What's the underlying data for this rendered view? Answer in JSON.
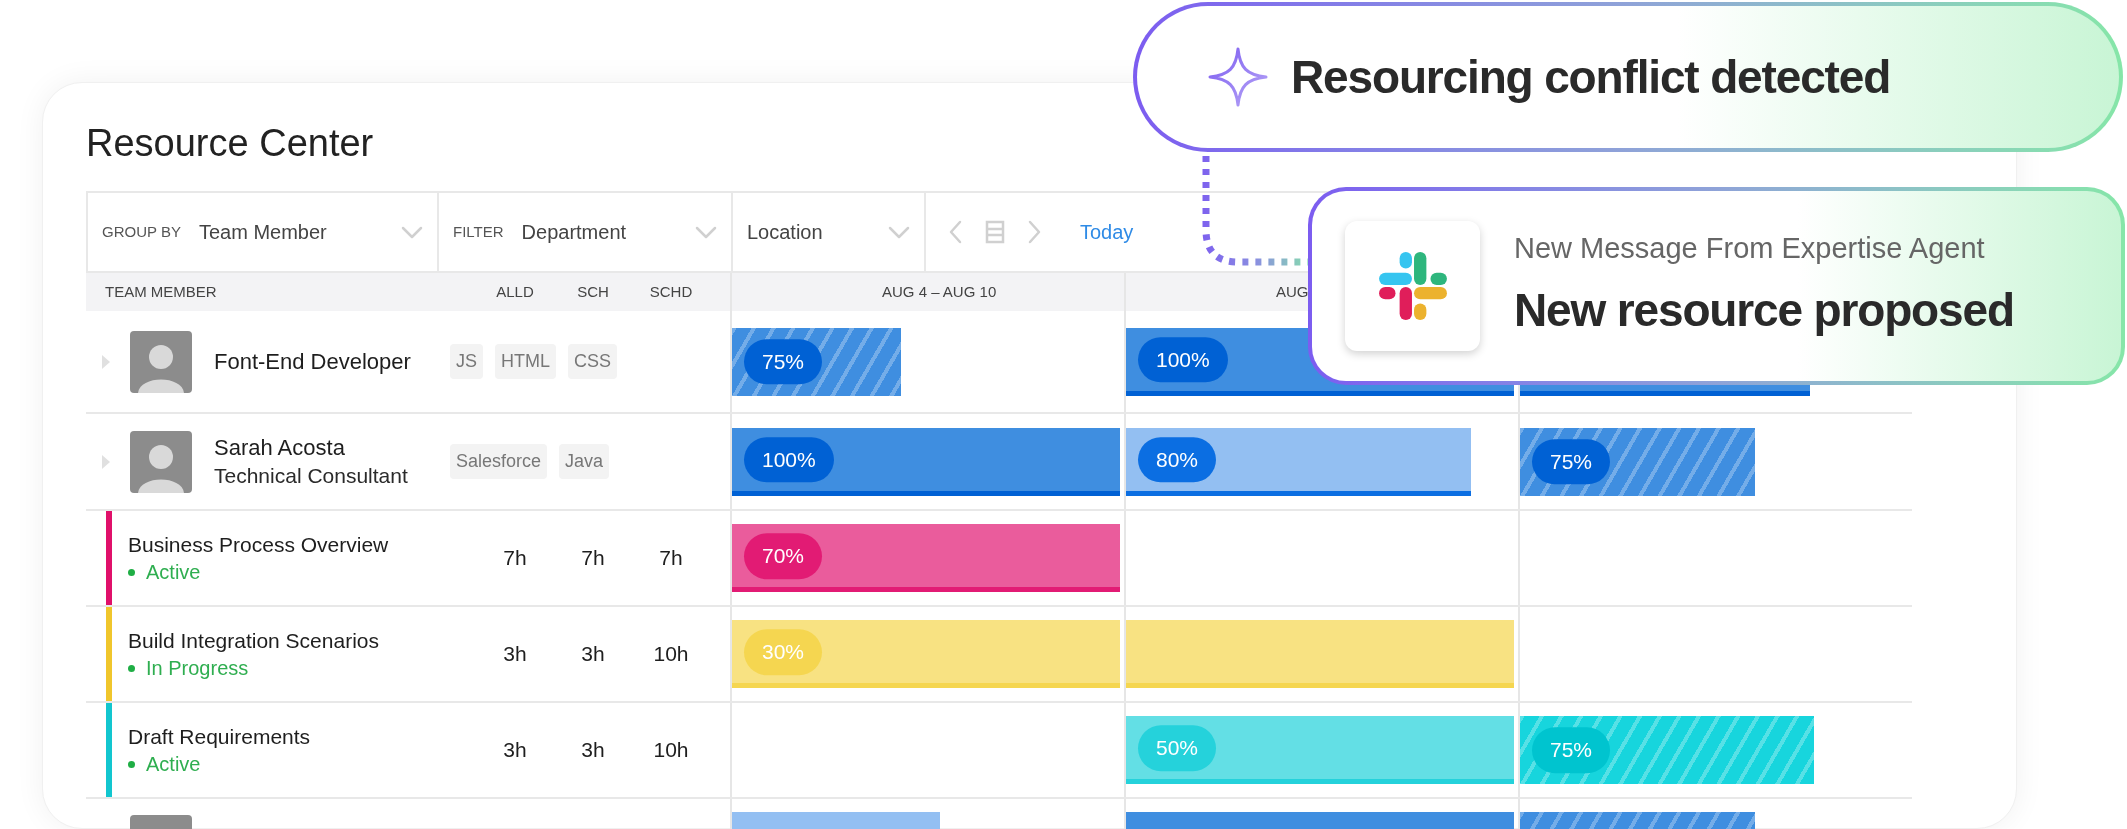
{
  "title": "Resource Center",
  "toolbar": {
    "group_by": {
      "label": "GROUP BY",
      "value": "Team Member"
    },
    "filter": {
      "label": "FILTER",
      "value": "Department"
    },
    "location": {
      "value": "Location"
    },
    "today": "Today"
  },
  "columns": {
    "member": "TEAM MEMBER",
    "hours": [
      "ALLD",
      "SCH",
      "SCHD"
    ],
    "weeks": [
      "AUG 4 – AUG 10",
      "AUG"
    ]
  },
  "rows": [
    {
      "kind": "member",
      "name": "Font-End Developer",
      "tags": [
        "JS",
        "HTML",
        "CSS"
      ],
      "week_1": {
        "kind": "hatched",
        "color": "#3f8ee0",
        "label": "75%",
        "level": 0.43
      },
      "week_2": {
        "kind": "solid",
        "color": "#3f8ee0",
        "label": "100%",
        "level": 0.99
      },
      "week_3": {
        "kind": "solid",
        "color": "#3f8ee0",
        "level": 0.74
      }
    },
    {
      "kind": "member",
      "name": "Sarah Acosta",
      "role": "Technical Consultant",
      "tags": [
        "Salesforce",
        "Java"
      ],
      "week_1": {
        "kind": "solid",
        "color": "#3f8ee0",
        "label": "100%",
        "level": 0.99
      },
      "week_2": {
        "kind": "light",
        "color": "#93bff2",
        "label": "80%",
        "level": 0.88
      },
      "week_3": {
        "kind": "hatched",
        "color": "#3f8ee0",
        "label": "75%",
        "level": 0.6
      }
    },
    {
      "kind": "task",
      "name": "Business Process Overview",
      "status": "Active",
      "color": "#e0106a",
      "hours": [
        "7h",
        "7h",
        "7h"
      ],
      "week_1": {
        "kind": "solid",
        "color": "#ea5c9c",
        "label": "70%",
        "level": 0.99
      }
    },
    {
      "kind": "task",
      "name": "Build Integration Scenarios",
      "status": "In Progress",
      "color": "#f0c62c",
      "hours": [
        "3h",
        "3h",
        "10h"
      ],
      "week_1": {
        "kind": "solid",
        "color": "#f8e282",
        "label": "30%",
        "level": 0.99
      },
      "week_2": {
        "kind": "solid",
        "color": "#f8e282",
        "level": 0.99
      }
    },
    {
      "kind": "task",
      "name": "Draft Requirements",
      "status": "Active",
      "color": "#12c6cf",
      "hours": [
        "3h",
        "3h",
        "10h"
      ],
      "week_2": {
        "kind": "solid",
        "color": "#63dfe5",
        "label": "50%",
        "level": 0.99
      },
      "week_3": {
        "kind": "hatched",
        "color": "#17d5dd",
        "label": "75%",
        "level": 0.75
      }
    },
    {
      "kind": "member",
      "tags": [],
      "week_1": {
        "kind": "light",
        "color": "#93bff2",
        "level": 0.53
      },
      "week_2": {
        "kind": "solid",
        "color": "#3f8ee0",
        "level": 0.99
      },
      "week_3": {
        "kind": "hatched",
        "color": "#3f8ee0",
        "level": 0.6
      }
    }
  ],
  "alert": {
    "text": "Resourcing conflict detected"
  },
  "message": {
    "sender": "New Message From Expertise Agent",
    "text": "New resource proposed"
  }
}
